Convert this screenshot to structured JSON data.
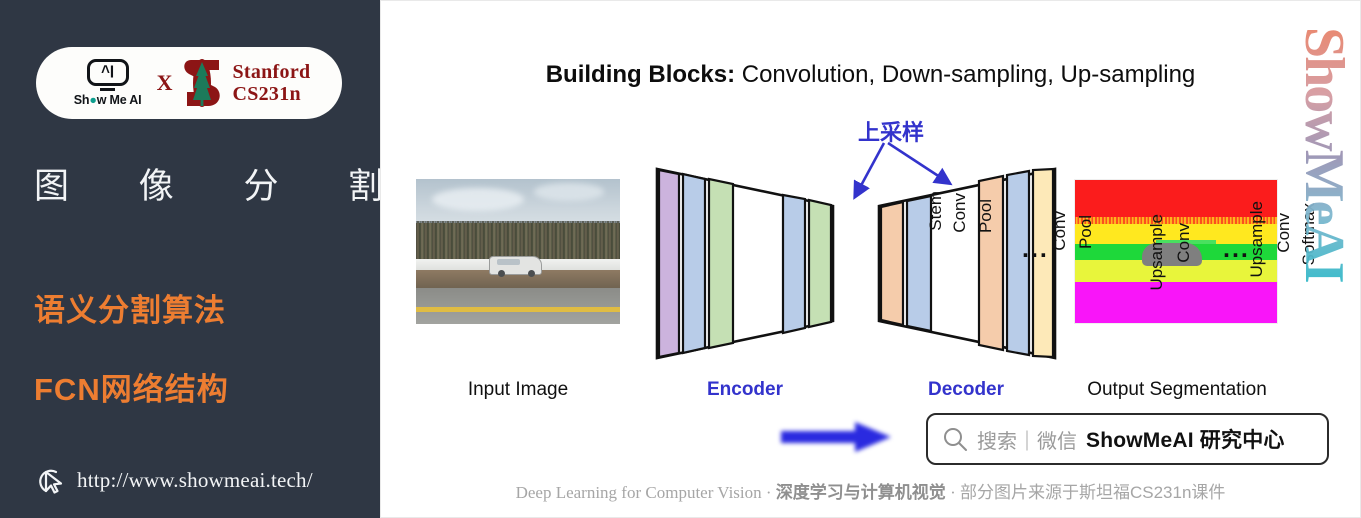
{
  "sidebar": {
    "logo": {
      "showmeai_label": "Show Me AI",
      "cross_label": "X",
      "stanford_line1": "Stanford",
      "stanford_line2": "CS231n",
      "icon_glyph": "^I"
    },
    "topic_title": "图 像 分 割",
    "headings": [
      "语义分割算法",
      "FCN网络结构"
    ],
    "url": "http://www.showmeai.tech/"
  },
  "main": {
    "slide_title_bold": "Building Blocks:",
    "slide_title_rest": " Convolution, Down-sampling, Up-sampling",
    "annotation_upsample": "上采样",
    "input_caption": "Input Image",
    "output_caption": "Output Segmentation",
    "encoder_label": "Encoder",
    "decoder_label": "Decoder",
    "encoder_blocks": [
      "Stem",
      "Conv",
      "Pool",
      "Conv",
      "Pool"
    ],
    "encoder_ellipsis": "...",
    "decoder_blocks": [
      "Upsample",
      "Conv",
      "Upsample",
      "Conv",
      "Softmax"
    ],
    "decoder_ellipsis": "...",
    "search": {
      "placeholder": "搜索｜微信",
      "brand": "ShowMeAI 研究中心"
    },
    "footer_en": "Deep Learning for Computer Vision ",
    "footer_sep1": "· ",
    "footer_cjk_bold": "深度学习与计算机视觉",
    "footer_sep2": " · ",
    "footer_cjk_tail": "部分图片来源于斯坦福CS231n课件",
    "watermark": "ShowMeAI"
  },
  "colors": {
    "sidebar_bg": "#2f3744",
    "accent_orange": "#ed7d31",
    "accent_blue": "#3333cc",
    "stanford_red": "#8c1515",
    "block_stem": "#ccb3dd",
    "block_conv": "#b8cce8",
    "block_pool": "#c5e0b4",
    "block_upsample": "#f5ccab",
    "block_softmax": "#fde9b8"
  }
}
